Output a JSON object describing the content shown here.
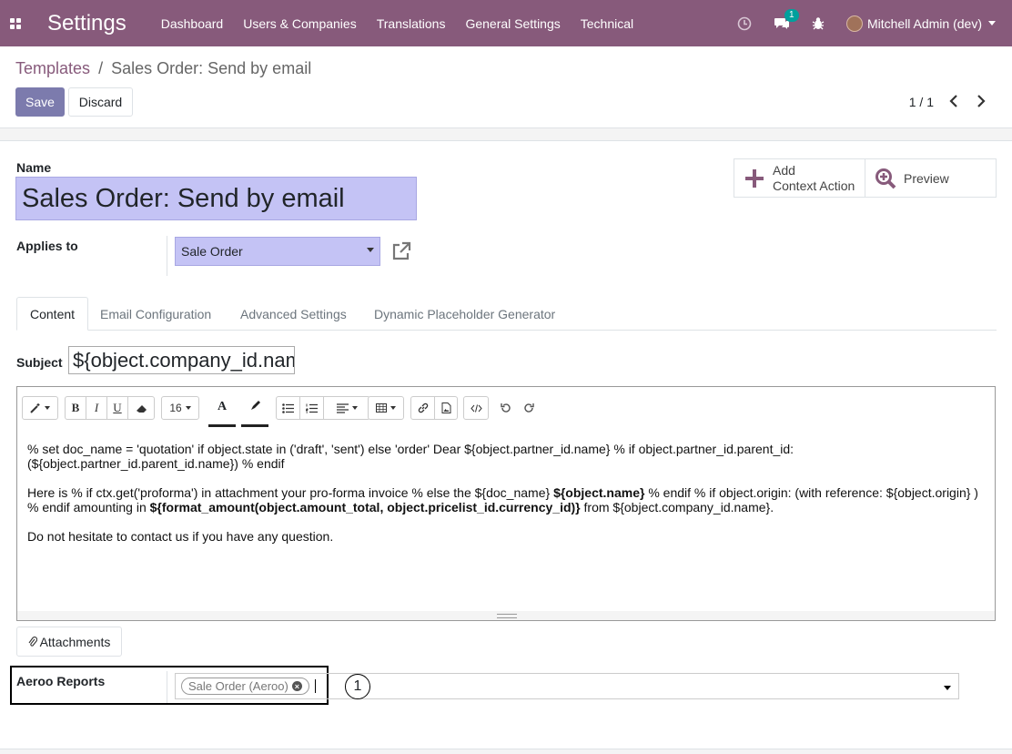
{
  "navbar": {
    "app_title": "Settings",
    "menu": [
      "Dashboard",
      "Users & Companies",
      "Translations",
      "General Settings",
      "Technical"
    ],
    "messages_badge": "1",
    "user": "Mitchell Admin (dev)",
    "bg_color": "#875a7b"
  },
  "breadcrumb": {
    "parent": "Templates",
    "separator": "/",
    "current": "Sales Order: Send by email"
  },
  "actions": {
    "save": "Save",
    "discard": "Discard"
  },
  "pager": {
    "value": "1 / 1"
  },
  "form": {
    "name_label": "Name",
    "name_value": "Sales Order: Send by email",
    "applies_to_label": "Applies to",
    "applies_to_value": "Sale Order",
    "buttons": {
      "context_action_line1": "Add",
      "context_action_line2": "Context Action",
      "preview": "Preview"
    },
    "tabs": [
      "Content",
      "Email Configuration",
      "Advanced Settings",
      "Dynamic Placeholder Generator"
    ],
    "subject_label": "Subject",
    "subject_value": "${object.company_id.name}",
    "font_size": "16",
    "body": {
      "p1": "% set doc_name = 'quotation' if object.state in ('draft', 'sent') else 'order' Dear ${object.partner_id.name} % if object.partner_id.parent_id: (${object.partner_id.parent_id.name}) % endif",
      "p2_a": "Here is % if ctx.get('proforma') in attachment your pro-forma invoice % else the ${doc_name} ",
      "p2_b": "${object.name}",
      "p2_c": " % endif % if object.origin: (with reference: ${object.origin} ) % endif amounting in ",
      "p2_d": "${format_amount(object.amount_total, object.pricelist_id.currency_id)}",
      "p2_e": " from ${object.company_id.name}.",
      "p3": "Do not hesitate to contact us if you have any question."
    },
    "attachments_button": "Attachments",
    "aeroo_label": "Aeroo Reports",
    "aeroo_tag": "Sale Order (Aeroo)",
    "annotation_marker": "1"
  }
}
